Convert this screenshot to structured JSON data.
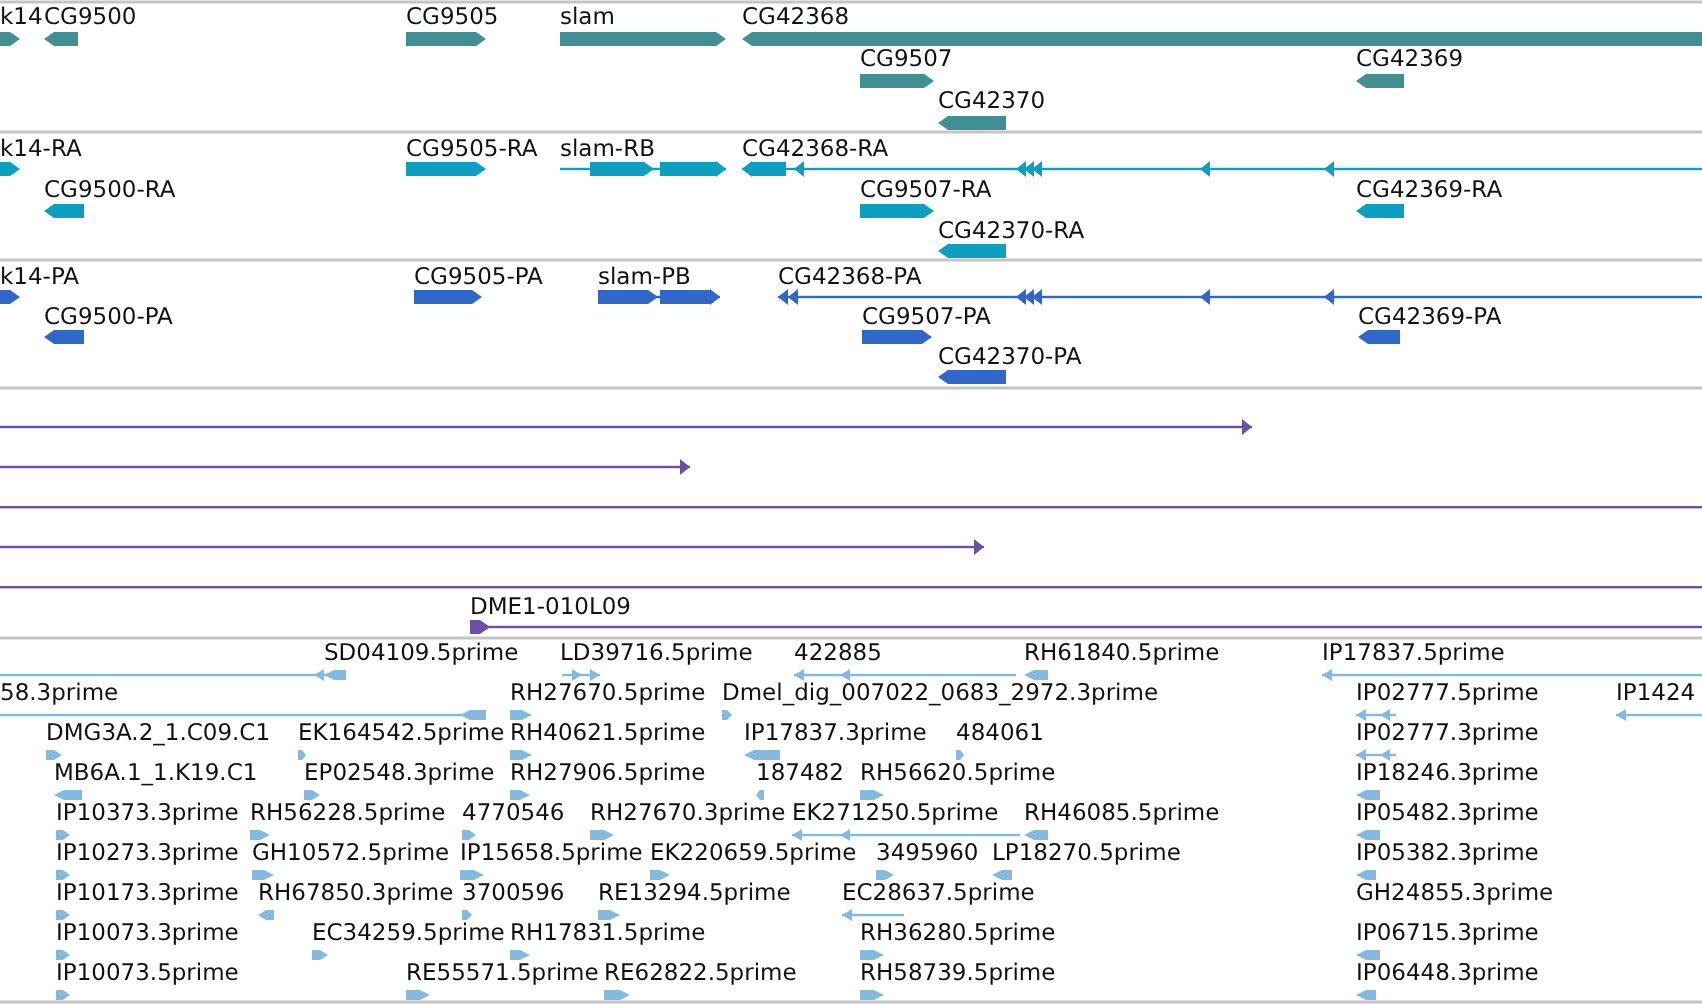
{
  "tracks": [
    {
      "kind": "gene",
      "features": [
        {
          "label": "k14",
          "reverse": false
        },
        {
          "label": "CG9500",
          "reverse": true
        },
        {
          "label": "CG9505",
          "reverse": false
        },
        {
          "label": "slam",
          "reverse": false
        },
        {
          "label": "CG42368",
          "reverse": true
        },
        {
          "label": "CG9507",
          "reverse": false
        },
        {
          "label": "CG42370",
          "reverse": true
        },
        {
          "label": "CG42369",
          "reverse": true
        }
      ]
    },
    {
      "kind": "transcript",
      "features": [
        {
          "label": "k14-RA",
          "reverse": false
        },
        {
          "label": "CG9500-RA",
          "reverse": true
        },
        {
          "label": "CG9505-RA",
          "reverse": false
        },
        {
          "label": "slam-RB",
          "reverse": false
        },
        {
          "label": "CG42368-RA",
          "reverse": true
        },
        {
          "label": "CG9507-RA",
          "reverse": false
        },
        {
          "label": "CG42370-RA",
          "reverse": true
        },
        {
          "label": "CG42369-RA",
          "reverse": true
        }
      ]
    },
    {
      "kind": "protein",
      "features": [
        {
          "label": "k14-PA",
          "reverse": false
        },
        {
          "label": "CG9500-PA",
          "reverse": true
        },
        {
          "label": "CG9505-PA",
          "reverse": false
        },
        {
          "label": "slam-PB",
          "reverse": false
        },
        {
          "label": "CG42368-PA",
          "reverse": true
        },
        {
          "label": "CG9507-PA",
          "reverse": false
        },
        {
          "label": "CG42370-PA",
          "reverse": true
        },
        {
          "label": "CG42369-PA",
          "reverse": true
        }
      ]
    },
    {
      "kind": "alignment",
      "features": [
        {
          "kind": "arrow",
          "reverse": false
        },
        {
          "kind": "arrow",
          "reverse": false
        },
        {
          "kind": "span"
        },
        {
          "kind": "arrow",
          "reverse": false
        },
        {
          "kind": "span"
        },
        {
          "kind": "arrow",
          "label": "DME1-010L09",
          "reverse": false
        }
      ]
    },
    {
      "kind": "est",
      "features": [
        {
          "label": "SD04109.5prime",
          "reverse": true
        },
        {
          "label": "LD39716.5prime",
          "reverse": false
        },
        {
          "label": "422885",
          "reverse": true
        },
        {
          "label": "RH61840.5prime",
          "reverse": true
        },
        {
          "label": "IP17837.5prime",
          "reverse": true
        },
        {
          "label": "58.3prime",
          "reverse": true
        },
        {
          "label": "RH27670.5prime",
          "reverse": false
        },
        {
          "label": "Dmel_dig_007022_0683_2972.3prime",
          "reverse": false
        },
        {
          "label": "IP02777.5prime",
          "reverse": true
        },
        {
          "label": "IP1424",
          "reverse": true
        },
        {
          "label": "DMG3A.2_1.C09.C1",
          "reverse": false
        },
        {
          "label": "EK164542.5prime",
          "reverse": false
        },
        {
          "label": "RH40621.5prime",
          "reverse": false
        },
        {
          "label": "IP17837.3prime",
          "reverse": true
        },
        {
          "label": "484061",
          "reverse": false
        },
        {
          "label": "IP02777.3prime",
          "reverse": true
        },
        {
          "label": "MB6A.1_1.K19.C1",
          "reverse": true
        },
        {
          "label": "EP02548.3prime",
          "reverse": false
        },
        {
          "label": "RH27906.5prime",
          "reverse": false
        },
        {
          "label": "187482",
          "reverse": true
        },
        {
          "label": "RH56620.5prime",
          "reverse": false
        },
        {
          "label": "IP18246.3prime",
          "reverse": true
        },
        {
          "label": "IP10373.3prime",
          "reverse": false
        },
        {
          "label": "RH56228.5prime",
          "reverse": false
        },
        {
          "label": "4770546",
          "reverse": false
        },
        {
          "label": "RH27670.3prime",
          "reverse": false
        },
        {
          "label": "EK271250.5prime",
          "reverse": true
        },
        {
          "label": "RH46085.5prime",
          "reverse": true
        },
        {
          "label": "IP05482.3prime",
          "reverse": true
        },
        {
          "label": "IP10273.3prime",
          "reverse": false
        },
        {
          "label": "GH10572.5prime",
          "reverse": false
        },
        {
          "label": "IP15658.5prime",
          "reverse": false
        },
        {
          "label": "EK220659.5prime",
          "reverse": false
        },
        {
          "label": "3495960",
          "reverse": false
        },
        {
          "label": "LP18270.5prime",
          "reverse": true
        },
        {
          "label": "IP05382.3prime",
          "reverse": true
        },
        {
          "label": "IP10173.3prime",
          "reverse": false
        },
        {
          "label": "RH67850.3prime",
          "reverse": true
        },
        {
          "label": "3700596",
          "reverse": false
        },
        {
          "label": "RE13294.5prime",
          "reverse": false
        },
        {
          "label": "EC28637.5prime",
          "reverse": true
        },
        {
          "label": "GH24855.3prime"
        },
        {
          "label": "IP10073.3prime",
          "reverse": false
        },
        {
          "label": "EC34259.5prime",
          "reverse": false
        },
        {
          "label": "RH17831.5prime",
          "reverse": false
        },
        {
          "label": "RH36280.5prime",
          "reverse": false
        },
        {
          "label": "IP06715.3prime",
          "reverse": true
        },
        {
          "label": "IP10073.5prime",
          "reverse": false
        },
        {
          "label": "RE55571.5prime",
          "reverse": false
        },
        {
          "label": "RE62822.5prime",
          "reverse": false
        },
        {
          "label": "RH58739.5prime",
          "reverse": false
        },
        {
          "label": "IP06448.3prime",
          "reverse": true
        }
      ]
    }
  ]
}
